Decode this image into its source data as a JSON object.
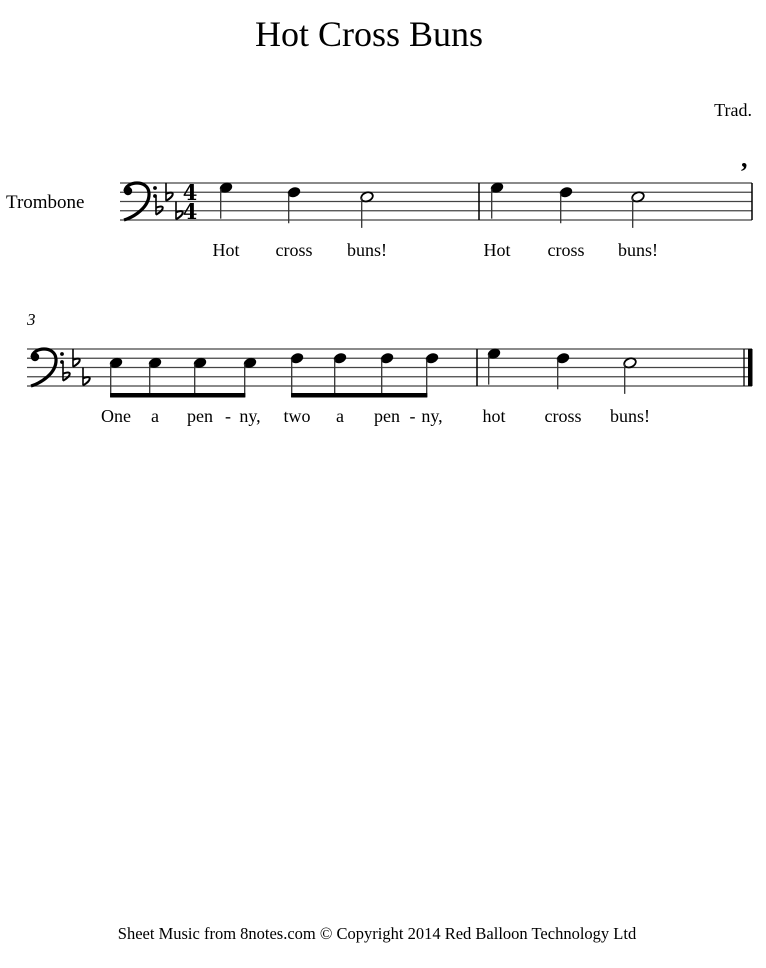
{
  "title": "Hot Cross Buns",
  "composer": "Trad.",
  "instrument": "Trombone",
  "clef": "bass",
  "key_signature": {
    "flats": 3,
    "name": "E-flat major"
  },
  "time_signature": {
    "numerator": "4",
    "denominator": "4"
  },
  "footer": "Sheet Music from 8notes.com © Copyright 2014 Red Balloon Technology Ltd",
  "systems": [
    {
      "measure_number": "",
      "measures": [
        {
          "notes": [
            {
              "pitch": "G3",
              "duration": "quarter",
              "lyric": "Hot"
            },
            {
              "pitch": "F3",
              "duration": "quarter",
              "lyric": "cross"
            },
            {
              "pitch": "Eb3",
              "duration": "half",
              "lyric": "buns!"
            }
          ]
        },
        {
          "notes": [
            {
              "pitch": "G3",
              "duration": "quarter",
              "lyric": "Hot"
            },
            {
              "pitch": "F3",
              "duration": "quarter",
              "lyric": "cross"
            },
            {
              "pitch": "Eb3",
              "duration": "half",
              "lyric": "buns!"
            }
          ],
          "breath_mark": true
        }
      ]
    },
    {
      "measure_number": "3",
      "measures": [
        {
          "notes": [
            {
              "pitch": "Eb3",
              "duration": "eighth",
              "lyric": "One"
            },
            {
              "pitch": "Eb3",
              "duration": "eighth",
              "lyric": "a"
            },
            {
              "pitch": "Eb3",
              "duration": "eighth",
              "lyric": "pen",
              "hyphen": true
            },
            {
              "pitch": "Eb3",
              "duration": "eighth",
              "lyric": "ny,"
            },
            {
              "pitch": "F3",
              "duration": "eighth",
              "lyric": "two"
            },
            {
              "pitch": "F3",
              "duration": "eighth",
              "lyric": "a"
            },
            {
              "pitch": "F3",
              "duration": "eighth",
              "lyric": "pen",
              "hyphen": true
            },
            {
              "pitch": "F3",
              "duration": "eighth",
              "lyric": "ny,"
            }
          ]
        },
        {
          "notes": [
            {
              "pitch": "G3",
              "duration": "quarter",
              "lyric": "hot"
            },
            {
              "pitch": "F3",
              "duration": "quarter",
              "lyric": "cross"
            },
            {
              "pitch": "Eb3",
              "duration": "half",
              "lyric": "buns!"
            }
          ],
          "final_barline": true
        }
      ]
    }
  ],
  "hyphen_char": "-",
  "breath_char": ","
}
